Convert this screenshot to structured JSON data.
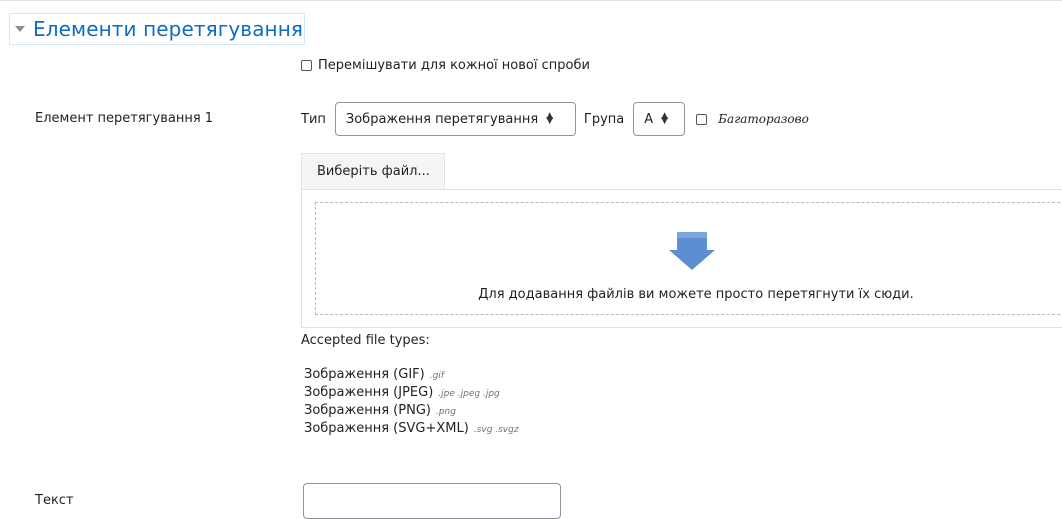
{
  "section": {
    "title": "Елементи перетягування"
  },
  "shuffle": {
    "label": "Перемішувати для кожної нової спроби",
    "checked": false
  },
  "drag_item": {
    "label": "Елемент перетягування 1",
    "type_label": "Тип",
    "type_value": "Зображення перетягування",
    "group_label": "Група",
    "group_value": "A",
    "infinite_label": "Багаторазово",
    "infinite_checked": false
  },
  "filepicker": {
    "button_label": "Виберіть файл...",
    "drop_hint": "Для додавання файлів ви можете просто перетягнути їх сюди.",
    "accepted_label": "Accepted file types:",
    "types": [
      {
        "name": "Зображення (GIF)",
        "ext": ".gif"
      },
      {
        "name": "Зображення (JPEG)",
        "ext": ".jpe .jpeg .jpg"
      },
      {
        "name": "Зображення (PNG)",
        "ext": ".png"
      },
      {
        "name": "Зображення (SVG+XML)",
        "ext": ".svg .svgz"
      }
    ]
  },
  "text_field": {
    "label": "Текст",
    "value": ""
  },
  "icons": {
    "collapse": "chevron-down-icon",
    "select": "sort-arrows-icon",
    "drop": "arrow-down-icon"
  },
  "colors": {
    "accent": "#0f6cbf",
    "drop_arrow": "#5b8fd1"
  }
}
